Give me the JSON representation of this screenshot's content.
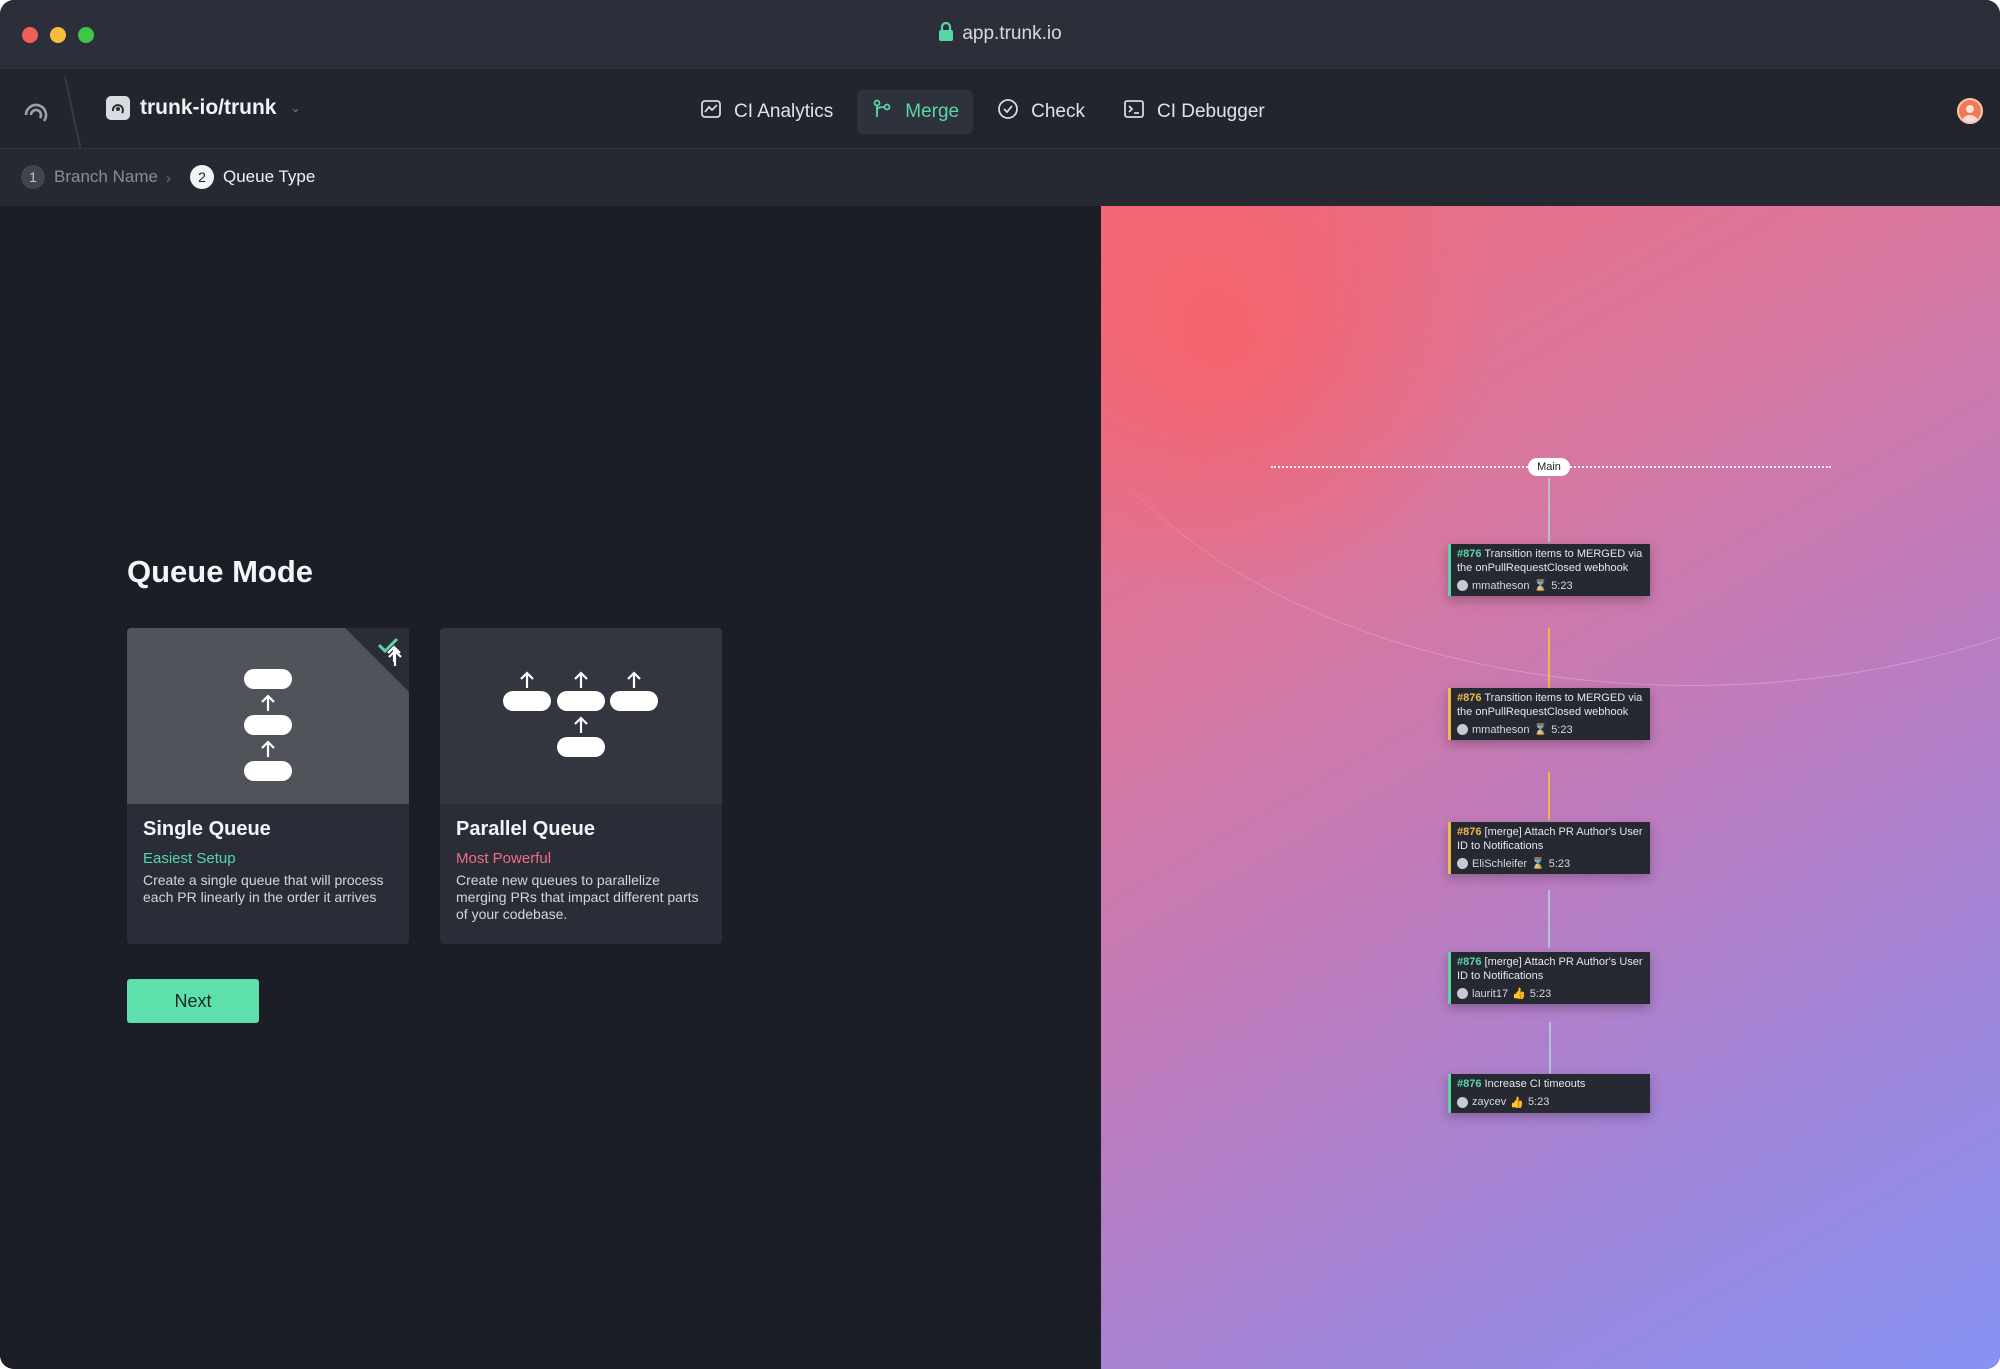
{
  "browser": {
    "url": "app.trunk.io"
  },
  "header": {
    "repo": "trunk-io/trunk",
    "nav": [
      {
        "label": "CI Analytics",
        "icon": "analytics-icon",
        "active": false
      },
      {
        "label": "Merge",
        "icon": "merge-icon",
        "active": true
      },
      {
        "label": "Check",
        "icon": "check-circle-icon",
        "active": false
      },
      {
        "label": "CI Debugger",
        "icon": "terminal-icon",
        "active": false
      }
    ]
  },
  "breadcrumb": [
    {
      "num": "1",
      "label": "Branch Name"
    },
    {
      "num": "2",
      "label": "Queue Type"
    }
  ],
  "queue": {
    "heading": "Queue Mode",
    "cards": [
      {
        "title": "Single Queue",
        "subtitle": "Easiest Setup",
        "description": "Create a single queue that will process each PR linearly in the order it arrives",
        "selected": true
      },
      {
        "title": "Parallel Queue",
        "subtitle": "Most Powerful",
        "description": "Create new queues to parallelize merging PRs that impact different parts of your codebase.",
        "selected": false
      }
    ],
    "next_label": "Next"
  },
  "preview": {
    "main_label": "Main",
    "prs": [
      {
        "num": "#876",
        "text": "Transition items to MERGED via the onPullRequestClosed webhook",
        "user": "mmatheson",
        "time": "5:23",
        "status": "green"
      },
      {
        "num": "#876",
        "text": "Transition items to MERGED via the onPullRequestClosed webhook",
        "user": "mmatheson",
        "time": "5:23",
        "status": "yellow"
      },
      {
        "num": "#876",
        "text": "[merge] Attach PR Author's User ID to Notifications",
        "user": "EliSchleifer",
        "time": "5:23",
        "status": "yellow"
      },
      {
        "num": "#876",
        "text": "[merge] Attach PR Author's User ID to Notifications",
        "user": "laurit17",
        "time": "5:23",
        "status": "green"
      },
      {
        "num": "#876",
        "text": "Increase CI timeouts",
        "user": "zaycev",
        "time": "5:23",
        "status": "green"
      }
    ]
  },
  "colors": {
    "accent": "#5ad6a6",
    "warning": "#f2b84a",
    "danger": "#ef6d87"
  }
}
